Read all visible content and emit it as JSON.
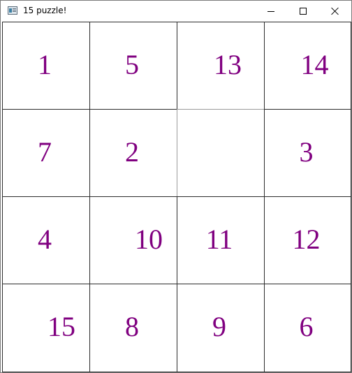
{
  "window": {
    "title": "15 puzzle!",
    "icon": "app-icon",
    "controls": [
      "minimize-icon",
      "maximize-icon",
      "close-icon"
    ]
  },
  "colors": {
    "tile_text": "#800080",
    "grid_line": "#2b2b2b",
    "empty_border": "#9a9a9a"
  },
  "board": {
    "rows": [
      [
        "1",
        "5",
        "13",
        "14"
      ],
      [
        "7",
        "2",
        "",
        "3"
      ],
      [
        "4",
        "10",
        "11",
        "12"
      ],
      [
        "15",
        "8",
        "9",
        "6"
      ]
    ]
  }
}
